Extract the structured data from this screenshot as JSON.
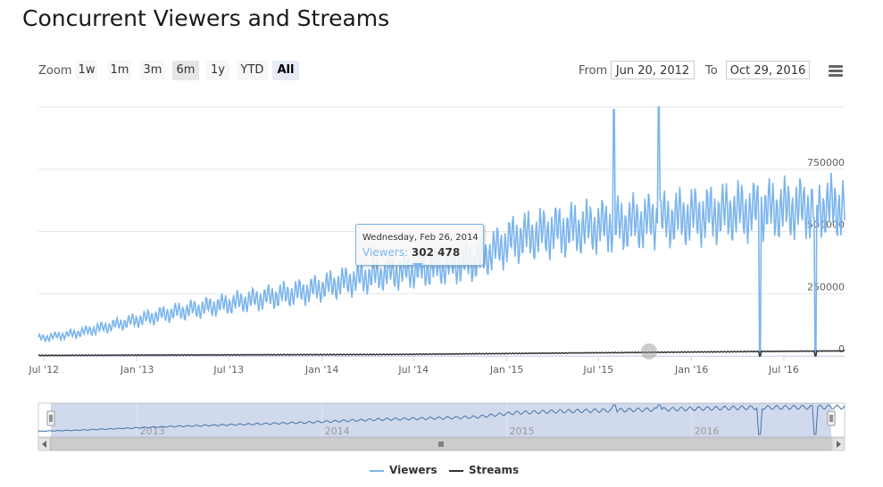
{
  "title": "Concurrent Viewers and Streams",
  "range_selector": {
    "zoom_label": "Zoom",
    "buttons": [
      "1w",
      "1m",
      "3m",
      "6m",
      "1y",
      "YTD",
      "All"
    ],
    "selected": "All",
    "from_label": "From",
    "from_value": "Jun 20, 2012",
    "to_label": "To",
    "to_value": "Oct 29, 2016"
  },
  "menu_icon": "hamburger-menu-icon",
  "tooltip": {
    "date": "Wednesday, Feb 26, 2014",
    "series": "Viewers",
    "value": "302 478"
  },
  "navigator": {
    "year_labels": [
      "2013",
      "2014",
      "2015",
      "2016"
    ]
  },
  "legend": [
    {
      "name": "Viewers",
      "color": "#7cb5ec"
    },
    {
      "name": "Streams",
      "color": "#333333"
    }
  ],
  "chart_data": {
    "type": "line",
    "title": "Concurrent Viewers and Streams",
    "xlabel": "",
    "ylabel": "",
    "x_tick_labels": [
      "Jul '12",
      "Jan '13",
      "Jul '13",
      "Jan '14",
      "Jul '14",
      "Jan '15",
      "Jul '15",
      "Jan '16",
      "Jul '16"
    ],
    "y_tick_labels": [
      "0",
      "250000",
      "500000",
      "750000"
    ],
    "ylim": [
      0,
      1000000
    ],
    "x_range": [
      "2012-06-20",
      "2016-10-29"
    ],
    "grid": true,
    "legend_position": "bottom-center",
    "series": [
      {
        "name": "Viewers",
        "color": "#7cb5ec",
        "x": [
          "2012-06-20",
          "2012-09-01",
          "2012-12-01",
          "2013-03-01",
          "2013-06-01",
          "2013-09-01",
          "2013-12-01",
          "2014-02-26",
          "2014-05-01",
          "2014-08-01",
          "2014-11-01",
          "2015-01-15",
          "2015-04-01",
          "2015-07-01",
          "2015-10-01",
          "2016-01-01",
          "2016-04-01",
          "2016-07-01",
          "2016-10-29"
        ],
        "values": [
          70000,
          90000,
          130000,
          170000,
          200000,
          230000,
          260000,
          302478,
          330000,
          350000,
          380000,
          470000,
          500000,
          520000,
          540000,
          560000,
          580000,
          590000,
          600000
        ],
        "spikes": [
          {
            "x": "2015-08-01",
            "value": 990000
          },
          {
            "x": "2015-10-28",
            "value": 1000000
          },
          {
            "x": "2016-05-15",
            "value": 0
          },
          {
            "x": "2016-09-01",
            "value": 0
          }
        ]
      },
      {
        "name": "Streams",
        "color": "#333333",
        "x": [
          "2012-06-20",
          "2013-06-01",
          "2014-06-01",
          "2015-06-01",
          "2016-06-01",
          "2016-10-29"
        ],
        "values": [
          2000,
          4000,
          6000,
          12000,
          18000,
          20000
        ]
      }
    ]
  }
}
